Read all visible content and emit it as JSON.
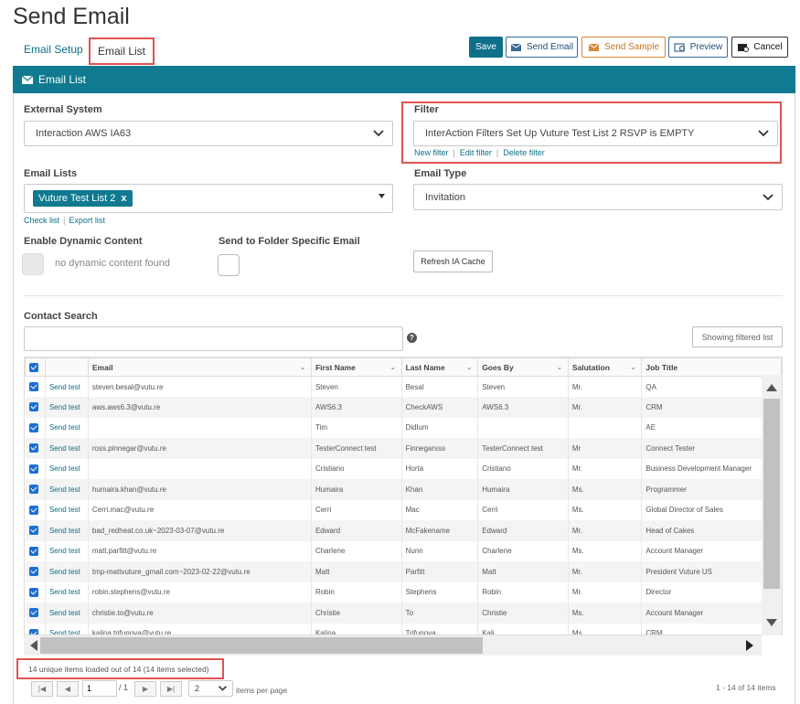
{
  "page": {
    "title": "Send Email"
  },
  "tabs": {
    "setup": "Email Setup",
    "list": "Email List"
  },
  "toolbar": {
    "save": "Save",
    "send_email": "Send Email",
    "send_sample": "Send Sample",
    "preview": "Preview",
    "cancel": "Cancel"
  },
  "panel": {
    "title": "Email List"
  },
  "external_system": {
    "label": "External System",
    "value": "Interaction AWS IA63"
  },
  "filter": {
    "label": "Filter",
    "value": "InterAction Filters Set Up Vuture Test List 2 RSVP is EMPTY",
    "new": "New filter",
    "edit": "Edit filter",
    "delete": "Delete filter"
  },
  "email_lists": {
    "label": "Email Lists",
    "tag": "Vuture Test List 2",
    "tag_remove": "x",
    "check": "Check list",
    "export": "Export list"
  },
  "email_type": {
    "label": "Email Type",
    "value": "Invitation"
  },
  "dynamic_content": {
    "label": "Enable Dynamic Content",
    "note": "no dynamic content found"
  },
  "folder_specific": {
    "label": "Send to Folder Specific Email"
  },
  "refresh_button": "Refresh IA Cache",
  "contact_search": {
    "label": "Contact Search",
    "value": "",
    "help": "?"
  },
  "showing_filtered": "Showing filtered list",
  "grid": {
    "columns": [
      "Email",
      "First Name",
      "Last Name",
      "Goes By",
      "Salutation",
      "Job Title"
    ],
    "send_test": "Send test",
    "rows": [
      [
        "steven.besal@vutu.re",
        "Steven",
        "Besal",
        "Steven",
        "Mr.",
        "QA"
      ],
      [
        "aws.aws6.3@vutu.re",
        "AWS6.3",
        "CheckAWS",
        "AWS6.3",
        "Mr.",
        "CRM"
      ],
      [
        "",
        "Tim",
        "Didlum",
        "",
        "",
        "AE"
      ],
      [
        "ross.pinnegar@vutu.re",
        "TesterConnect test",
        "Finnegarsss",
        "TesterConnect test",
        "Mr",
        "Connect Tester"
      ],
      [
        "",
        "Cristiano",
        "Horta",
        "Cristiano",
        "Mr.",
        "Business Development Manager"
      ],
      [
        "humaira.khan@vutu.re",
        "Humaira",
        "Khan",
        "Humaira",
        "Ms.",
        "Programmer"
      ],
      [
        "Cerri.mac@vutu.re",
        "Cerri",
        "Mac",
        "Cerri",
        "Ms.",
        "Global Director of Sales"
      ],
      [
        "bad_redheat.co.uk~2023-03-07@vutu.re",
        "Edward",
        "McFakename",
        "Edward",
        "Mr.",
        "Head of Cakes"
      ],
      [
        "matt.parfitt@vutu.re",
        "Charlene",
        "Nunn",
        "Charlene",
        "Ms.",
        "Account Manager"
      ],
      [
        "tmp-mattvuture_gmail.com~2023-02-22@vutu.re",
        "Matt",
        "Parfitt",
        "Matt",
        "Mr.",
        "President Vuture US"
      ],
      [
        "robin.stephens@vutu.re",
        "Robin",
        "Stephens",
        "Robin",
        "Mr.",
        "Director"
      ],
      [
        "christie.to@vutu.re",
        "Christie",
        "To",
        "Christie",
        "Ms.",
        "Account Manager"
      ],
      [
        "kalina.trifunova@vutu.re",
        "Kalina",
        "Trifunova",
        "Kali",
        "Ms.",
        "CRM"
      ]
    ]
  },
  "status": {
    "loaded": "14 unique items loaded out of 14 (14 items selected)"
  },
  "pager": {
    "page": "1",
    "of": "/ 1",
    "page_size": "2",
    "per_page": "items per page",
    "summary": "1 - 14 of 14 items",
    "first": "|◀",
    "prev": "◀",
    "next": "▶",
    "last": "▶|"
  },
  "colors": {
    "accent": "#0f7a90",
    "highlight": "#e05252",
    "checkbox": "#1b6fd1"
  }
}
